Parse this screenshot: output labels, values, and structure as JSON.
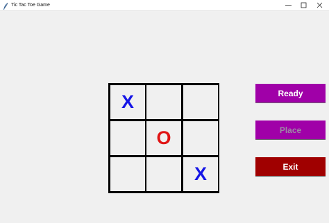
{
  "window": {
    "title": "Tic Tac Toe Game",
    "controls": [
      "minimize",
      "maximize",
      "close"
    ]
  },
  "board": {
    "rows": 3,
    "cols": 3,
    "cells": [
      [
        "X",
        "",
        ""
      ],
      [
        "",
        "O",
        ""
      ],
      [
        "",
        "",
        "X"
      ]
    ]
  },
  "buttons": {
    "ready": "Ready",
    "place": "Place",
    "exit": "Exit"
  },
  "colors": {
    "x_mark": "#1515e6",
    "o_mark": "#e01414",
    "ready_bg": "#a000a8",
    "place_bg": "#a000a8",
    "place_text_disabled": "#9c8aa4",
    "exit_bg": "#a00000",
    "grid_line": "#000000",
    "window_bg": "#f0f0f0"
  },
  "states": {
    "place_enabled": false
  }
}
